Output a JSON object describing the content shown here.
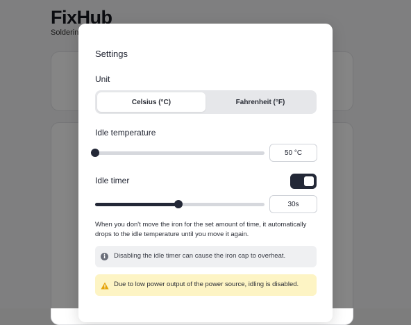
{
  "background": {
    "app_title": "FixHub",
    "subtitle": "Solderin"
  },
  "modal": {
    "title": "Settings",
    "unit": {
      "label": "Unit",
      "options": [
        "Celsius (°C)",
        "Fahrenheit (°F)"
      ],
      "selected": "Celsius (°C)"
    },
    "idle_temperature": {
      "label": "Idle temperature",
      "value_text": "50 °C",
      "slider_fraction": 0.0
    },
    "idle_timer": {
      "label": "Idle timer",
      "enabled": true,
      "value_text": "30s",
      "slider_fraction": 0.49
    },
    "description": "When you don't move the iron for the set amount of time, it automatically drops to the idle temperature until you move it again.",
    "info_message": "Disabling the idle timer can cause the iron cap to overheat.",
    "warning_message": "Due to low power output of the power source, idling is disabled."
  },
  "colors": {
    "accent": "#232837",
    "warning_bg": "#fdf4c4",
    "warning_icon": "#e5a50a",
    "info_bg": "#eff0f2"
  },
  "icons": {
    "info": "info-circle-icon",
    "warning": "warning-triangle-icon"
  }
}
